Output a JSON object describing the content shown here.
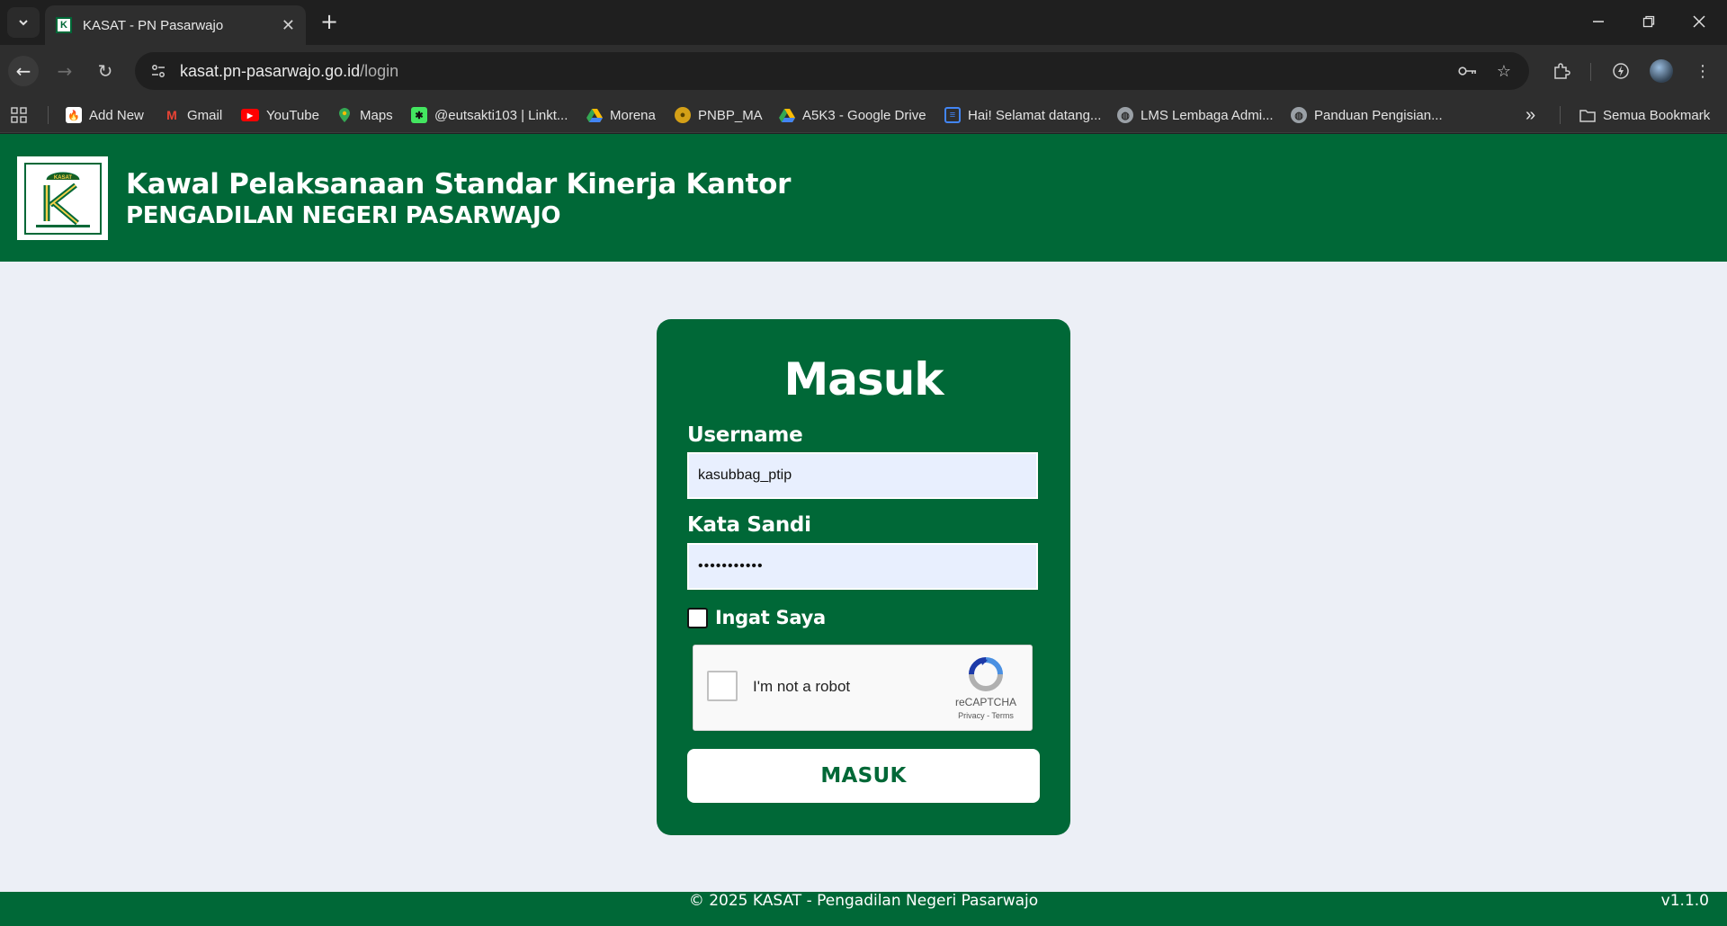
{
  "browser": {
    "tab": {
      "title": "KASAT - PN Pasarwajo",
      "favicon": "kasat-logo-icon"
    },
    "address": {
      "host": "kasat.pn-pasarwajo.go.id",
      "path": "/login"
    },
    "bookmarks": [
      {
        "label": "Add New",
        "icon": "fire-icon",
        "color": "#e8e8e8"
      },
      {
        "label": "Gmail",
        "icon": "gmail-icon",
        "color": "#ea4335"
      },
      {
        "label": "YouTube",
        "icon": "youtube-icon",
        "color": "#ff0000"
      },
      {
        "label": "Maps",
        "icon": "maps-pin-icon",
        "color": "#34a853"
      },
      {
        "label": "@eutsakti103 | Linkt...",
        "icon": "linktree-icon",
        "color": "#43e660"
      },
      {
        "label": "Morena",
        "icon": "drive-icon",
        "color": "#fbbc04"
      },
      {
        "label": "PNBP_MA",
        "icon": "pnbp-icon",
        "color": "#d4a017"
      },
      {
        "label": "A5K3 - Google Drive",
        "icon": "drive-icon",
        "color": "#fbbc04"
      },
      {
        "label": "Hai! Selamat datang...",
        "icon": "page-icon",
        "color": "#4285f4"
      },
      {
        "label": "LMS Lembaga Admi...",
        "icon": "globe-icon",
        "color": "#9aa0a6"
      },
      {
        "label": "Panduan Pengisian...",
        "icon": "globe-icon",
        "color": "#9aa0a6"
      }
    ],
    "all_bookmarks_label": "Semua Bookmark"
  },
  "header": {
    "title": "Kawal Pelaksanaan Standar Kinerja Kantor",
    "subtitle": "PENGADILAN NEGERI PASARWAJO",
    "logo_text": "KASAT"
  },
  "login": {
    "title": "Masuk",
    "username_label": "Username",
    "username_value": "kasubbag_ptip",
    "password_label": "Kata Sandi",
    "password_value": "•••••••••••",
    "remember_label": "Ingat Saya",
    "captcha_label": "I'm not a robot",
    "captcha_brand": "reCAPTCHA",
    "captcha_links": "Privacy - Terms",
    "submit_label": "MASUK"
  },
  "footer": {
    "text": "© 2025 KASAT - Pengadilan Negeri Pasarwajo",
    "version": "v1.1.0"
  },
  "colors": {
    "brand_green": "#006837",
    "page_bg": "#eceff6"
  }
}
